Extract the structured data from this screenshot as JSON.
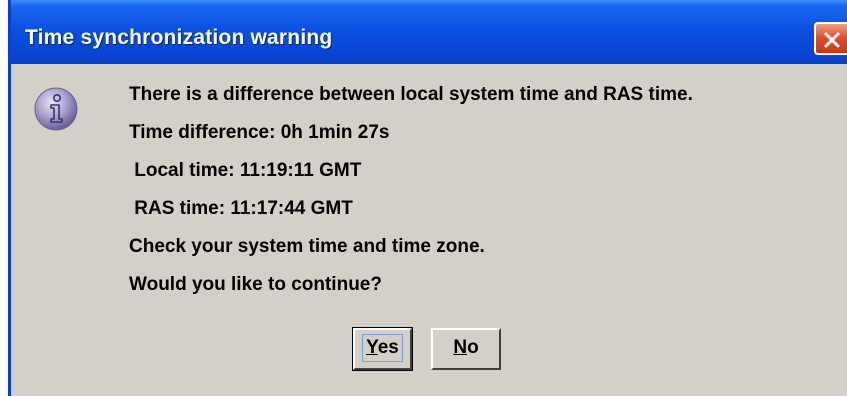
{
  "window": {
    "title": "Time synchronization warning"
  },
  "message": {
    "lines": [
      "There is a difference between local system time and RAS time.",
      "Time difference: 0h 1min 27s",
      " Local time: 11:19:11 GMT",
      " RAS time: 11:17:44 GMT",
      "Check your system time and time zone.",
      "Would you like to continue?"
    ]
  },
  "buttons": {
    "yes": {
      "mnemonic": "Y",
      "rest": "es"
    },
    "no": {
      "mnemonic": "N",
      "rest": "o"
    }
  },
  "icons": {
    "dialog": "information-icon",
    "close": "close-icon"
  },
  "colors": {
    "titlebar": "#0a4fe0",
    "dialog_bg": "#d4d0c8",
    "close_button": "#e05030"
  }
}
